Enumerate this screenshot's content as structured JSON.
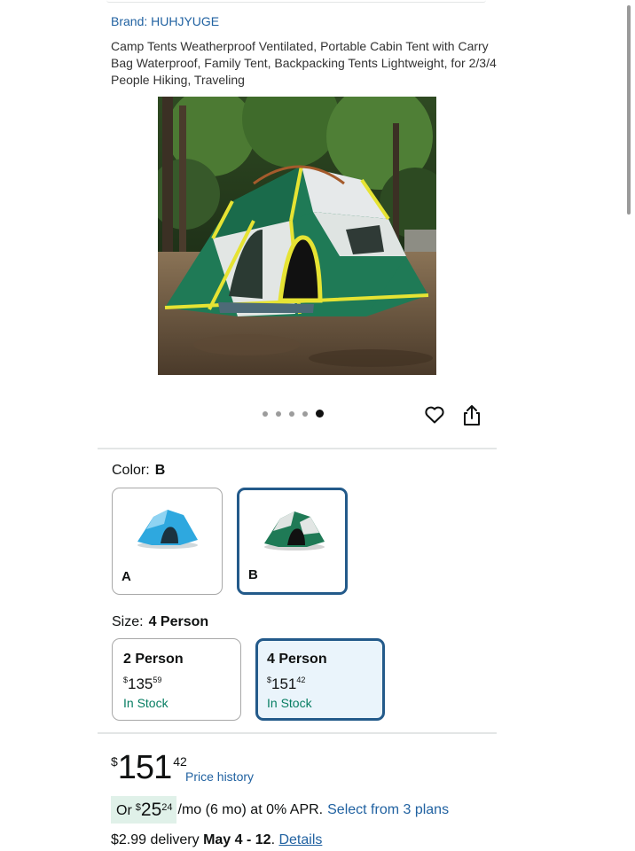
{
  "product": {
    "brand": "Brand: HUHJYUGE",
    "title": "Camp Tents Weatherproof Ventilated, Portable Cabin Tent with Carry Bag Waterproof, Family Tent, Backpacking Tents Lightweight, for 2/3/4 People Hiking, Traveling"
  },
  "gallery": {
    "dot_count": 5,
    "active_dot": 5,
    "heart_icon": "heart-outline-icon",
    "share_icon": "share-icon"
  },
  "color": {
    "label": "Color:",
    "selected": "B",
    "options": [
      {
        "letter": "A",
        "tent_color": "#2ea8df"
      },
      {
        "letter": "B",
        "tent_color": "#1f7a56"
      }
    ]
  },
  "size": {
    "label": "Size:",
    "selected": "4 Person",
    "options": [
      {
        "name": "2 Person",
        "currency": "$",
        "price_whole": "135",
        "price_fraction": "59",
        "stock": "In Stock"
      },
      {
        "name": "4 Person",
        "currency": "$",
        "price_whole": "151",
        "price_fraction": "42",
        "stock": "In Stock"
      }
    ]
  },
  "price": {
    "currency": "$",
    "whole": "151",
    "fraction": "42",
    "history_link": "Price history"
  },
  "financing": {
    "prefix": "Or",
    "currency": "$",
    "whole": "25",
    "fraction": "24",
    "terms": "/mo (6 mo) at 0% APR.",
    "plans_link": "Select from 3 plans"
  },
  "delivery": {
    "fee": "$2.99 delivery",
    "dates": "May 4 - 12",
    "separator": ".",
    "details_link": "Details"
  },
  "colors": {
    "link": "#2162a1",
    "selected_border": "#235a8a",
    "in_stock": "#067d62",
    "financing_bg": "#e0f1e9"
  }
}
